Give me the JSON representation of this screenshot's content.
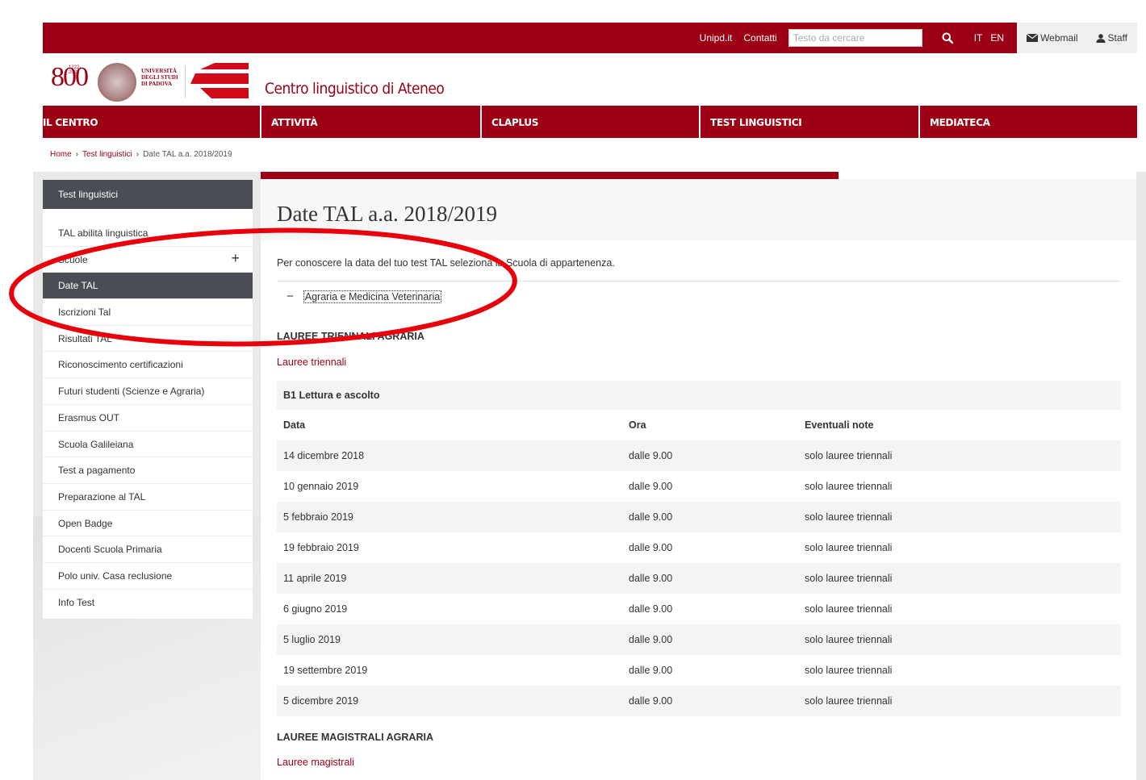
{
  "topbar": {
    "links": [
      "Unipd.it",
      "Contatti"
    ],
    "search_placeholder": "Testo da cercare",
    "lang_it": "IT",
    "lang_en": "EN",
    "webmail": "Webmail",
    "staff": "Staff"
  },
  "header": {
    "logo_number": "800",
    "logo_years": "1222-2022",
    "logo_anni": "ANNI",
    "university_name": [
      "UNIVERSITÀ",
      "DEGLI STUDI",
      "DI PADOVA"
    ],
    "site_title": "Centro linguistico di Ateneo"
  },
  "nav": [
    "IL CENTRO",
    "ATTIVITÀ",
    "CLAPLUS",
    "TEST LINGUISTICI",
    "MEDIATECA"
  ],
  "breadcrumb": [
    "Home",
    "Test linguistici",
    "Date TAL a.a. 2018/2019"
  ],
  "sidebar": {
    "heading": "Test linguistici",
    "items": [
      "TAL abilità linguistica",
      "Scuole",
      "Date TAL",
      "Iscrizioni Tal",
      "Risultati TAL",
      "Riconoscimento certificazioni",
      "Futuri studenti (Scienze e Agraria)",
      "Erasmus OUT",
      "Scuola Galileiana",
      "Test a pagamento",
      "Preparazione al TAL",
      "Open Badge",
      "Docenti Scuola Primaria",
      "Polo univ. Casa reclusione",
      "Info Test"
    ],
    "active_index": 2,
    "expand_symbol": "+"
  },
  "main": {
    "title": "Date TAL a.a. 2018/2019",
    "intro": "Per conoscere la data del tuo test TAL seleziona la Scuola di appartenenza.",
    "accordion_symbol": "−",
    "accordion_label": "Agraria e Medicina Veterinaria",
    "section1_heading": "LAUREE TRIENNALI AGRARIA",
    "section1_link": "Lauree triennali",
    "table_caption": "B1 Lettura e ascolto",
    "table_headers": [
      "Data",
      "Ora",
      "Eventuali note"
    ],
    "table_rows": [
      [
        "14 dicembre 2018",
        "dalle 9.00",
        "solo lauree triennali"
      ],
      [
        "10 gennaio 2019",
        "dalle 9.00",
        "solo lauree triennali"
      ],
      [
        "5 febbraio 2019",
        "dalle 9.00",
        "solo lauree triennali"
      ],
      [
        "19 febbraio 2019",
        "dalle 9.00",
        "solo lauree triennali"
      ],
      [
        "11 aprile 2019",
        "dalle 9.00",
        "solo lauree triennali"
      ],
      [
        "6 giugno 2019",
        "dalle 9.00",
        "solo lauree triennali"
      ],
      [
        "5 luglio 2019",
        "dalle 9.00",
        "solo lauree triennali"
      ],
      [
        "19 settembre 2019",
        "dalle 9.00",
        "solo lauree triennali"
      ],
      [
        "5 dicembre 2019",
        "dalle 9.00",
        "solo lauree triennali"
      ]
    ],
    "section2_heading": "LAUREE MAGISTRALI AGRARIA",
    "section2_link": "Lauree magistrali"
  },
  "colors": {
    "brand": "#9b0014",
    "sidebar_active": "#4a4d53",
    "annotation": "#e8000b"
  }
}
